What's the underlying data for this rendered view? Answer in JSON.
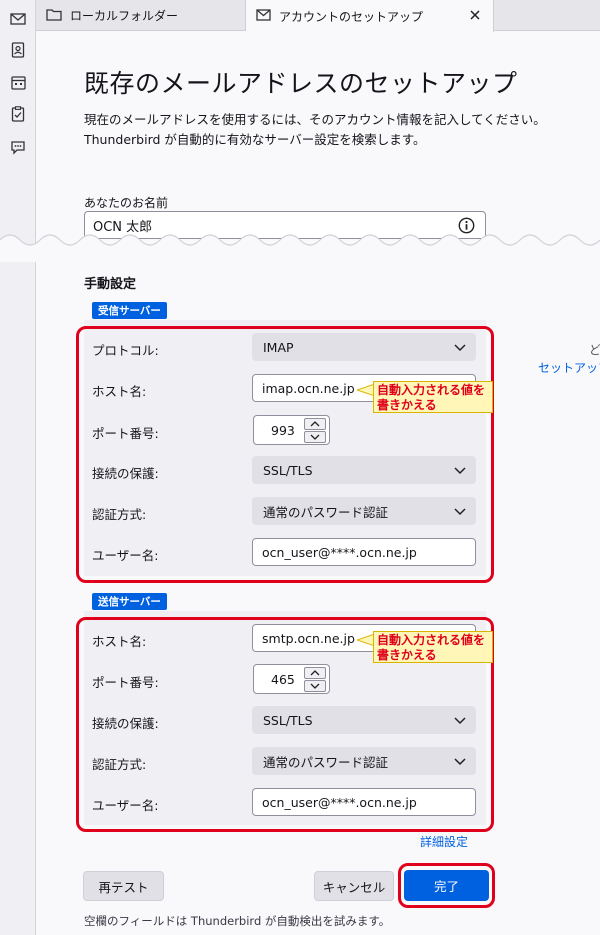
{
  "tabs": [
    {
      "label": "ローカルフォルダー",
      "icon": "folder-icon"
    },
    {
      "label": "アカウントのセットアップ",
      "icon": "mail-icon"
    }
  ],
  "spaces": [
    "mail-icon",
    "address-book-icon",
    "calendar-icon",
    "tasks-icon",
    "chat-icon"
  ],
  "page": {
    "title": "既存のメールアドレスのセットアップ",
    "desc_line1": "現在のメールアドレスを使用するには、そのアカウント情報を記入してください。",
    "desc_line2": "Thunderbird が自動的に有効なサーバー設定を検索します。"
  },
  "name_field": {
    "label": "あなたのお名前",
    "value": "OCN 太郎"
  },
  "manual": {
    "title": "手動設定",
    "incoming": {
      "badge": "受信サーバー",
      "protocol_label": "プロトコル:",
      "protocol_value": "IMAP",
      "host_label": "ホスト名:",
      "host_value": "imap.ocn.ne.jp",
      "port_label": "ポート番号:",
      "port_value": "993",
      "security_label": "接続の保護:",
      "security_value": "SSL/TLS",
      "auth_label": "認証方式:",
      "auth_value": "通常のパスワード認証",
      "user_label": "ユーザー名:",
      "user_value": "ocn_user@****.ocn.ne.jp"
    },
    "outgoing": {
      "badge": "送信サーバー",
      "host_label": "ホスト名:",
      "host_value": "smtp.ocn.ne.jp",
      "port_label": "ポート番号:",
      "port_value": "465",
      "security_label": "接続の保護:",
      "security_value": "SSL/TLS",
      "auth_label": "認証方式:",
      "auth_value": "通常のパスワード認証",
      "user_label": "ユーザー名:",
      "user_value": "ocn_user@****.ocn.ne.jp"
    },
    "callout_line1": "自動入力される値を",
    "callout_line2": "書きかえる",
    "advanced_link": "詳細設定"
  },
  "side_text": {
    "line1": "ど",
    "line2": "セットアップの"
  },
  "buttons": {
    "retest": "再テスト",
    "cancel": "キャンセル",
    "done": "完了"
  },
  "footer_note": "空欄のフィールドは Thunderbird が自動検出を試みます。",
  "colors": {
    "accent": "#0061e0",
    "highlight": "#e0001b",
    "callout_bg": "#fff6b8"
  }
}
